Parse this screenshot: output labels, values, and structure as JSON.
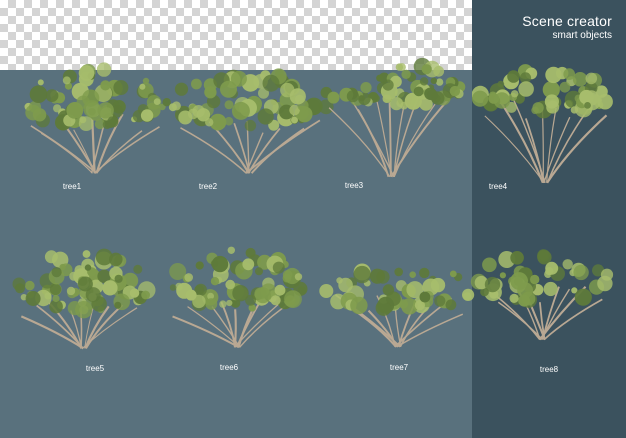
{
  "header": {
    "title": "Scene creator",
    "subtitle": "smart objects"
  },
  "colors": {
    "background": "#59717d",
    "panel": "#3b525e",
    "foliage_dark": "#5e7a3a",
    "foliage_mid": "#7e9b4c",
    "foliage_light": "#a7bd6c",
    "trunk": "#b9a893"
  },
  "trees": [
    {
      "label": "tree1",
      "shape": "wide-bush"
    },
    {
      "label": "tree2",
      "shape": "wide-bush"
    },
    {
      "label": "tree3",
      "shape": "tall-canopy"
    },
    {
      "label": "tree4",
      "shape": "tall-canopy"
    },
    {
      "label": "tree5",
      "shape": "round-bush"
    },
    {
      "label": "tree6",
      "shape": "round-bush"
    },
    {
      "label": "tree7",
      "shape": "sparse-shrub"
    },
    {
      "label": "tree8",
      "shape": "sparse-shrub"
    }
  ]
}
